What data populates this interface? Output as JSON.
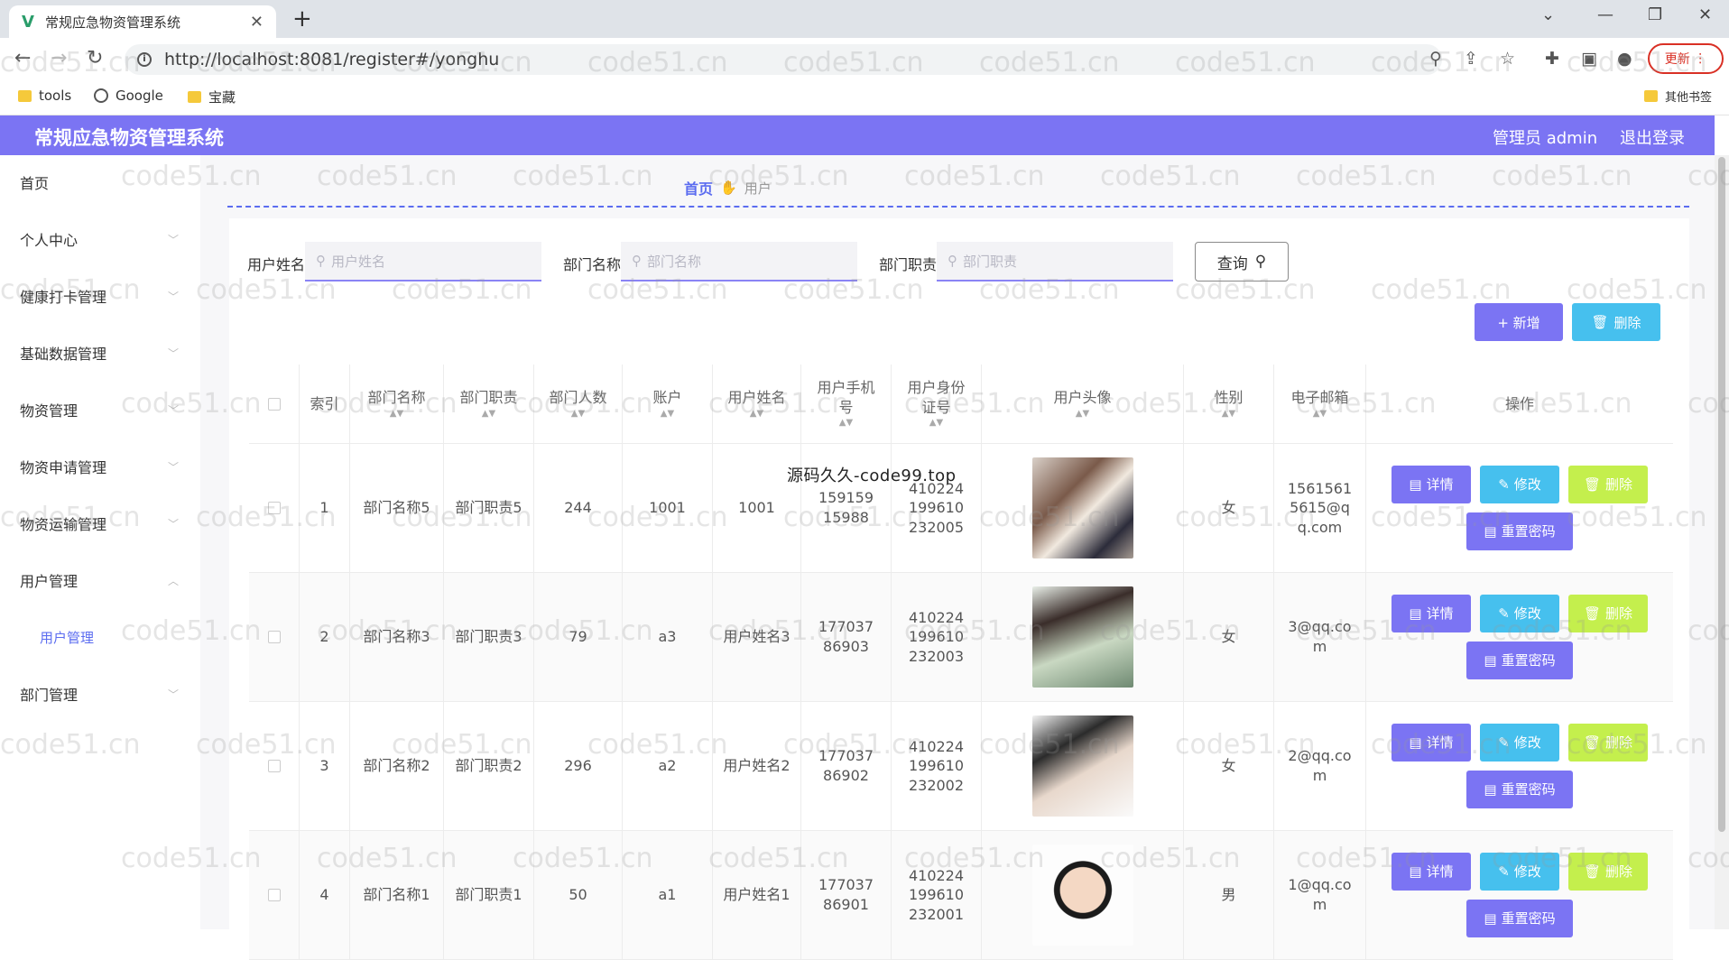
{
  "browser": {
    "tab_title": "常规应急物资管理系统",
    "url": "http://localhost:8081/register#/yonghu",
    "update_label": "更新",
    "bookmarks": [
      {
        "label": "tools",
        "icon": "folder-icon"
      },
      {
        "label": "Google",
        "icon": "globe-icon"
      },
      {
        "label": "宝藏",
        "icon": "folder-icon"
      }
    ],
    "other_bookmarks": "其他书签"
  },
  "header": {
    "title": "常规应急物资管理系统",
    "user": "管理员 admin",
    "logout": "退出登录",
    "accent": "#7b74f3"
  },
  "sidebar": {
    "items": [
      {
        "label": "首页"
      },
      {
        "label": "个人中心"
      },
      {
        "label": "健康打卡管理"
      },
      {
        "label": "基础数据管理"
      },
      {
        "label": "物资管理"
      },
      {
        "label": "物资申请管理"
      },
      {
        "label": "物资运输管理"
      },
      {
        "label": "用户管理"
      },
      {
        "label": "用户管理"
      },
      {
        "label": "部门管理"
      }
    ]
  },
  "breadcrumb": {
    "home": "首页",
    "current": "用户"
  },
  "search": {
    "name_label": "用户姓名",
    "name_placeholder": "用户姓名",
    "dept_label": "部门名称",
    "dept_placeholder": "部门名称",
    "duty_label": "部门职责",
    "duty_placeholder": "部门职责",
    "query_label": "查询"
  },
  "actions": {
    "add_label": "+ 新增",
    "delete_label": "删除"
  },
  "table": {
    "columns": [
      "索引",
      "部门名称",
      "部门职责",
      "部门人数",
      "账户",
      "用户姓名",
      "用户手机号",
      "用户身份证号",
      "用户头像",
      "性别",
      "电子邮箱",
      "操作"
    ],
    "rows": [
      {
        "index": "1",
        "dept": "部门名称5",
        "duty": "部门职责5",
        "count": "244",
        "account": "1001",
        "name": "1001",
        "phone": "15915915988",
        "idcard": "410224199610232005",
        "gender": "女",
        "email": "15615615615@qq.com"
      },
      {
        "index": "2",
        "dept": "部门名称3",
        "duty": "部门职责3",
        "count": "79",
        "account": "a3",
        "name": "用户姓名3",
        "phone": "17703786903",
        "idcard": "410224199610232003",
        "gender": "女",
        "email": "3@qq.com"
      },
      {
        "index": "3",
        "dept": "部门名称2",
        "duty": "部门职责2",
        "count": "296",
        "account": "a2",
        "name": "用户姓名2",
        "phone": "17703786902",
        "idcard": "410224199610232002",
        "gender": "女",
        "email": "2@qq.com"
      },
      {
        "index": "4",
        "dept": "部门名称1",
        "duty": "部门职责1",
        "count": "50",
        "account": "a1",
        "name": "用户姓名1",
        "phone": "17703786901",
        "idcard": "410224199610232001",
        "gender": "男",
        "email": "1@qq.com"
      }
    ],
    "op_detail": "详情",
    "op_edit": "修改",
    "op_delete": "删除",
    "op_reset": "重置密码"
  },
  "overlay_text": "源码久久-code99.top",
  "watermark": "code51.cn"
}
